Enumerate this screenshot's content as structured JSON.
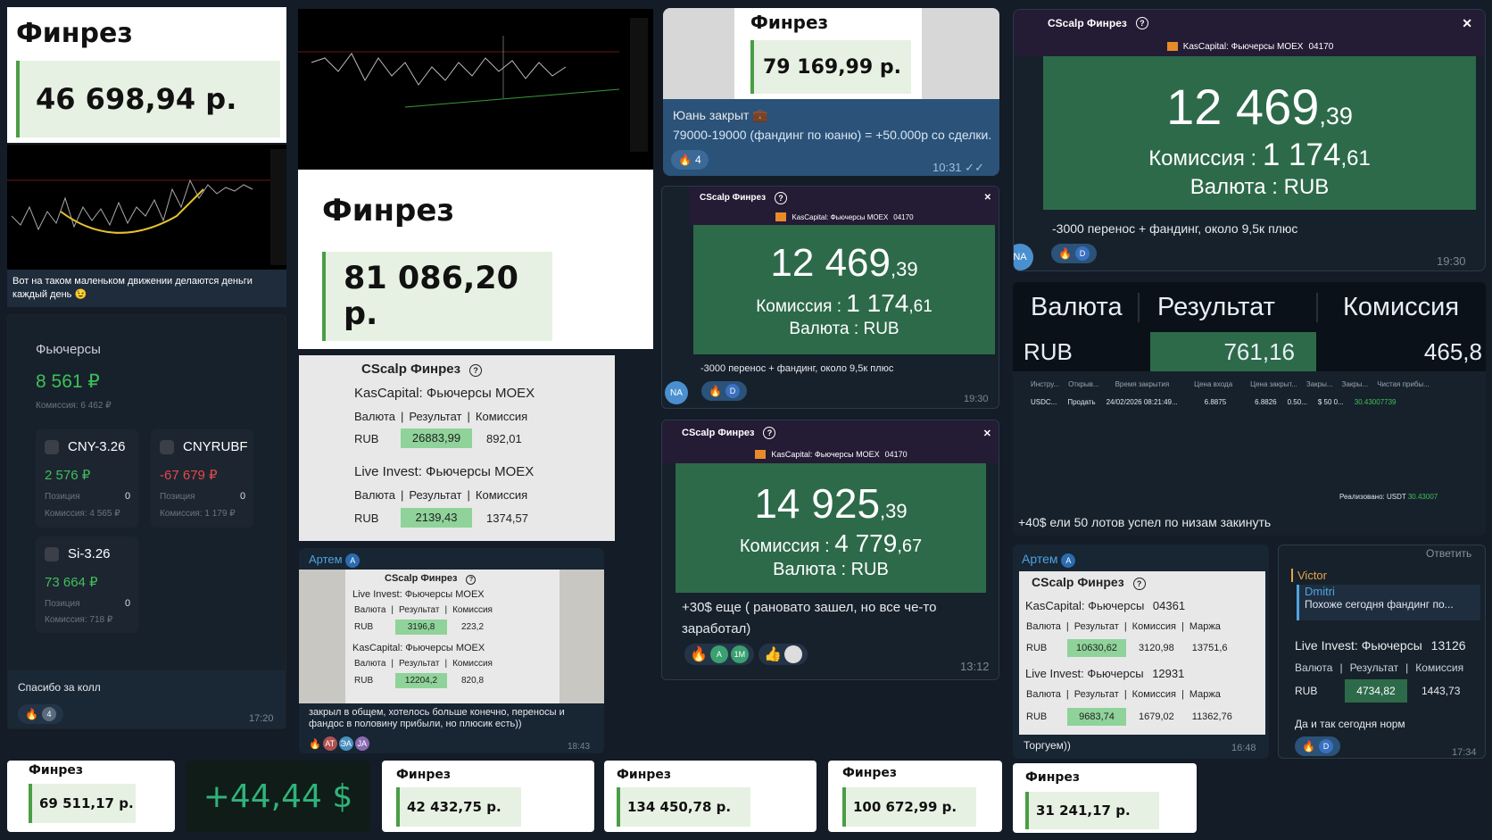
{
  "finrez": {
    "title": "Финрез",
    "v1": "46 698,94 р.",
    "v2": "81 086,20 р.",
    "v3": "79 169,99 р.",
    "b1": "69 511,17 р.",
    "b2": "42 432,75 р.",
    "b3": "134 450,78 р.",
    "b4": "100 672,99 р.",
    "b5": "31 241,17 р."
  },
  "usd_big": "+44,44 $",
  "chart1": {
    "caption": "Вот на таком маленьком движении делаются деньги каждый день 😉"
  },
  "yuan": {
    "line1": "Юань закрыт 💼",
    "line2": "79000-19000 (фандинг по юаню) = +50.000р со сделки.",
    "reaction_count": "4",
    "time": "10:31"
  },
  "futures": {
    "title": "Фьючерсы",
    "total": "8 561 ₽",
    "commission": "Комиссия: 6 462 ₽",
    "cards": [
      {
        "name": "CNY-3.26",
        "value": "2 576 ₽",
        "pos_label": "Позиция",
        "pos": "0",
        "comm": "Комиссия: 4 565 ₽"
      },
      {
        "name": "CNYRUBF",
        "value": "-67 679 ₽",
        "pos_label": "Позиция",
        "pos": "0",
        "comm": "Комиссия: 1 179 ₽"
      },
      {
        "name": "Si-3.26",
        "value": "73 664 ₽",
        "pos_label": "Позиция",
        "pos": "0",
        "comm": "Комиссия: 718 ₽"
      }
    ],
    "caption": "Спасибо за колл",
    "reaction_count": "4",
    "time": "17:20"
  },
  "cscalp": {
    "app": "CScalp Финрез",
    "account": "KasCapital: Фьючерсы MOEX",
    "account_id": "04170",
    "comm_label": "Комиссия :",
    "cur_label": "Валюта :",
    "cur": "RUB",
    "close": "✕",
    "note": "-3000 перенос + фандинг, около 9,5к плюс"
  },
  "tr_card": {
    "big": "12 469",
    "frac": ",39",
    "comm": "1 174",
    "comm_frac": ",61",
    "time": "19:30",
    "avatar": "NA",
    "chip": "D"
  },
  "mid_card": {
    "big": "12 469",
    "frac": ",39",
    "comm": "1 174",
    "comm_frac": ",61",
    "time": "19:30",
    "avatar": "NA",
    "chip": "D"
  },
  "c3": {
    "big": "14 925",
    "frac": ",39",
    "comm": "4 779",
    "comm_frac": ",67",
    "caption": "+30$ еще ( рановато зашел, но все че-то заработал)",
    "time": "13:12",
    "chips": [
      "A",
      "1M"
    ]
  },
  "tbl1": {
    "title": "CScalp Финрез",
    "sec1": "KasCapital: Фьючерсы MOEX",
    "sec2": "Live Invest: Фьючерсы MOEX",
    "h": [
      "Валюта",
      "Результат",
      "Комиссия"
    ],
    "r1": [
      "RUB",
      "26883,99",
      "892,01"
    ],
    "r2": [
      "RUB",
      "2139,43",
      "1374,57"
    ]
  },
  "artem": {
    "name": "Артем",
    "badge": "A",
    "title": "CScalp Финрез",
    "sec1": "Live Invest: Фьючерсы MOEX",
    "sec2": "KasCapital: Фьючерсы MOEX",
    "h": [
      "Валюта",
      "Результат",
      "Комиссия"
    ],
    "r1": [
      "RUB",
      "3196,8",
      "223,2"
    ],
    "r2": [
      "RUB",
      "12204,2",
      "820,8"
    ],
    "caption": "закрыл в общем, хотелось больше конечно, переносы и фандос в половину прибыли, но плюсик есть))",
    "time": "18:43",
    "chips": [
      "AT",
      "ЭА",
      "JA"
    ]
  },
  "res": {
    "h": [
      "Валюта",
      "Результат",
      "Комиссия"
    ],
    "cur": "RUB",
    "result": "761,16",
    "comm": "465,8",
    "cols": [
      "Инстру...",
      "Открыв...",
      "Время закрытия",
      "Цена входа",
      "Цена закрыт...",
      "Закры...",
      "Закры...",
      "Чистая прибы..."
    ],
    "row": [
      "USDC...",
      "Продать",
      "24/02/2026 08:21:49...",
      "6.8875",
      "6.8826",
      "0.50...",
      "$ 50 0...",
      "30.43007739"
    ],
    "realized_label": "Реализовано: USDT",
    "realized": "30.43007",
    "caption": "+40$ ели 50 лотов успел по низам закинуть"
  },
  "artem2": {
    "name": "Артем",
    "badge": "A",
    "title": "CScalp Финрез",
    "sec1": "KasCapital: Фьючерсы",
    "id1": "04361",
    "sec2": "Live Invest: Фьючерсы",
    "id2": "12931",
    "h": [
      "Валюта",
      "Результат",
      "Комиссия",
      "Маржа"
    ],
    "r1": [
      "RUB",
      "10630,62",
      "3120,98",
      "13751,6"
    ],
    "r2": [
      "RUB",
      "9683,74",
      "1679,02",
      "11362,76"
    ],
    "caption": "Торгуем))",
    "time": "16:48"
  },
  "victor": {
    "reply": "Ответить",
    "name": "Victor",
    "quoted_name": "Dmitri",
    "quoted": "Похоже сегодня фандинг по...",
    "sec": "Live Invest: Фьючерсы",
    "id": "13126",
    "h": [
      "Валюта",
      "Результат",
      "Комиссия"
    ],
    "r": [
      "RUB",
      "4734,82",
      "1443,73"
    ],
    "caption": "Да и так сегодня норм",
    "time": "17:34",
    "chip": "D"
  },
  "colors": {
    "bg": "#131c27",
    "card": "#17212b",
    "green": "#2d6a4a",
    "purple": "#241b35",
    "accent": "#4fa3e0"
  }
}
